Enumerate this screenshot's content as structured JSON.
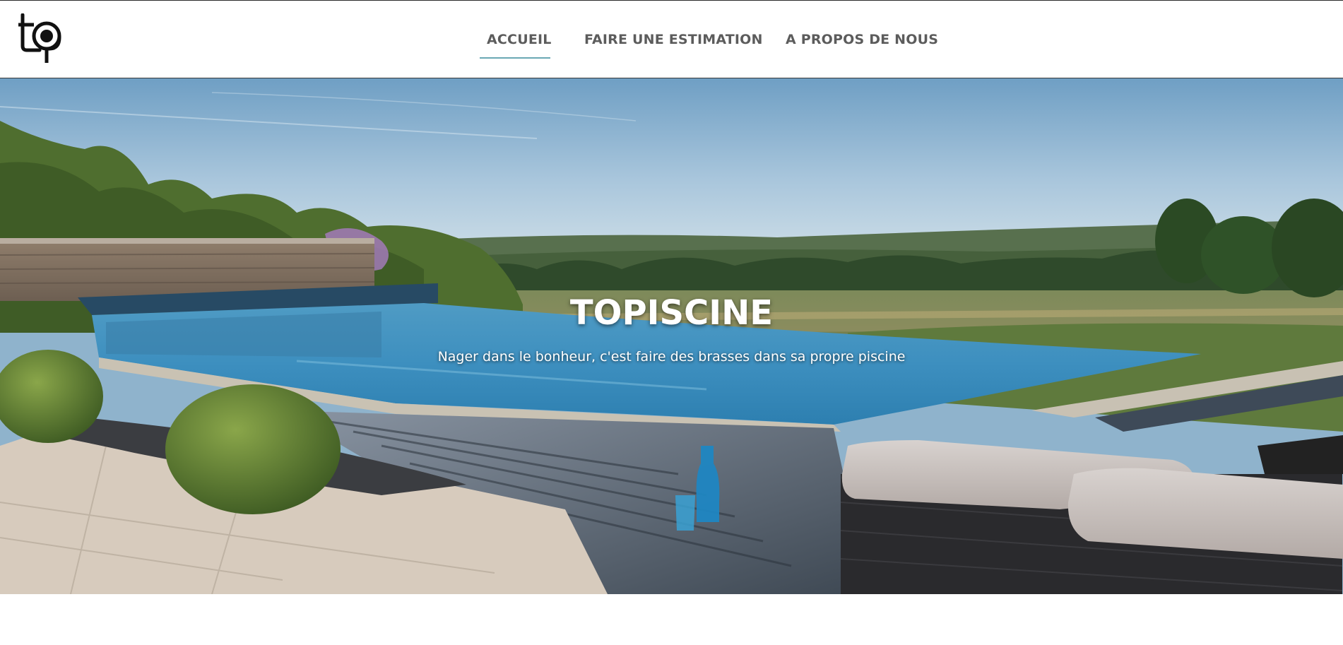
{
  "header": {
    "logo_alt": "tp",
    "nav": [
      {
        "label": "ACCUEIL",
        "active": true
      },
      {
        "label": "FAIRE UNE ESTIMATION",
        "active": false
      },
      {
        "label": "A PROPOS DE NOUS",
        "active": false
      }
    ]
  },
  "hero": {
    "title": "TOPISCINE",
    "subtitle": "Nager dans le bonheur, c'est faire des brasses dans sa propre piscine"
  },
  "colors": {
    "nav_text": "#5c5c5c",
    "nav_active_underline": "#6aa8b4",
    "hero_text": "#ffffff"
  }
}
